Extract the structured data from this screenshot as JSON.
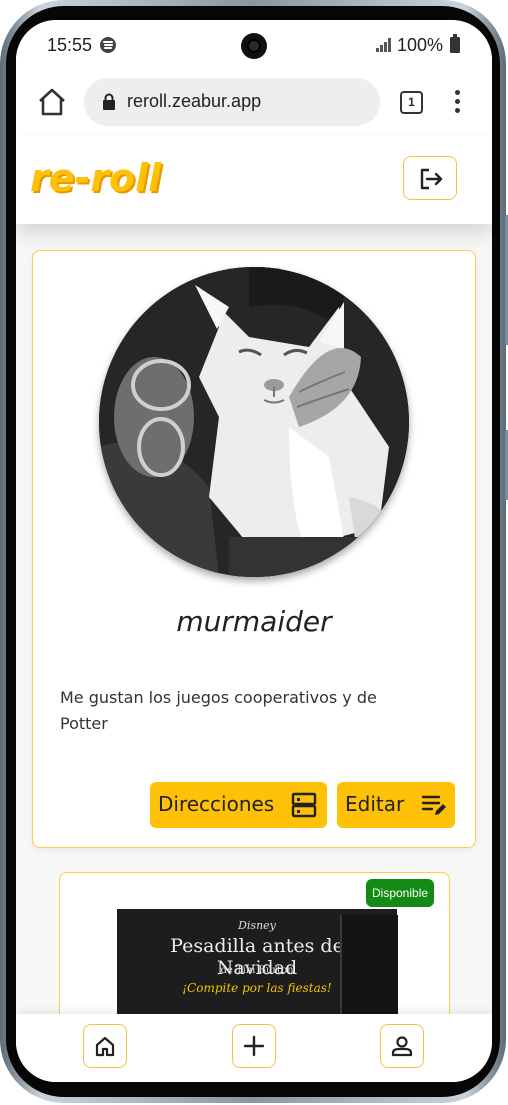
{
  "status_bar": {
    "time": "15:55",
    "battery": "100%",
    "icons": [
      "spotify-icon",
      "camera-cutout",
      "signal-icon",
      "battery-icon"
    ]
  },
  "browser": {
    "url": "reroll.zeabur.app",
    "tab_count": "1",
    "icons": [
      "home-icon",
      "lock-icon",
      "more-vert-icon"
    ]
  },
  "app": {
    "logo": "re-roll",
    "brand_color": "#ffc107",
    "header_icons": [
      "logout-icon"
    ]
  },
  "profile": {
    "username": "murmaider",
    "bio": "Me gustan los juegos cooperativos y de Potter",
    "buttons": {
      "addresses": "Direcciones",
      "edit": "Editar"
    },
    "button_icons": [
      "dns-icon",
      "edit-list-icon"
    ]
  },
  "game": {
    "status": "Disponible",
    "status_color": "#138a13",
    "cover": {
      "brand": "Disney",
      "title": "Pesadilla antes de Navidad",
      "subtitle": "de Tim Burton",
      "tagline": "¡Compite por las fiestas!"
    }
  },
  "bottom_nav": {
    "items": [
      "home-icon",
      "add-icon",
      "profile-icon"
    ]
  }
}
